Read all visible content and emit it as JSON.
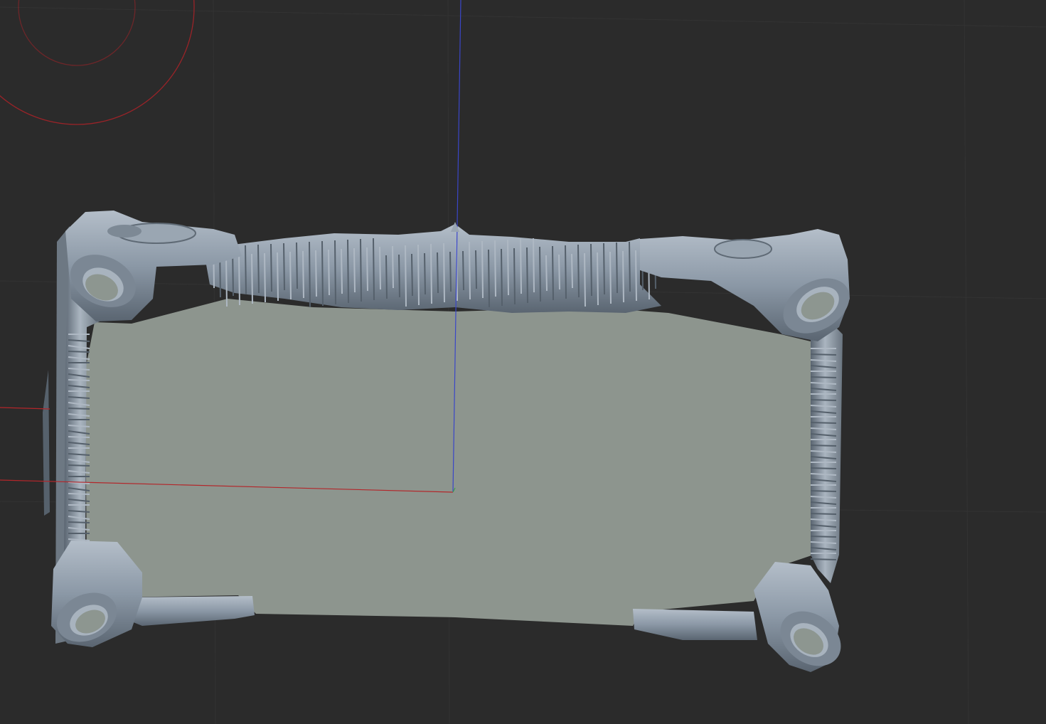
{
  "viewport": {
    "background_color": "#2b2b2b",
    "grid_color": "#333333",
    "axis_x_color": "#b3262a",
    "axis_z_color": "#3a46c8",
    "axis_y_color": "#3aa04a",
    "gizmo_color": "#9a2328"
  },
  "model": {
    "kind": "ornate-rectangular-frame",
    "view": "bottom",
    "base_color": "#8d958e",
    "rim_color": "#8b98a6",
    "rim_highlight": "#aeb8c3",
    "rim_shadow": "#55606b"
  }
}
